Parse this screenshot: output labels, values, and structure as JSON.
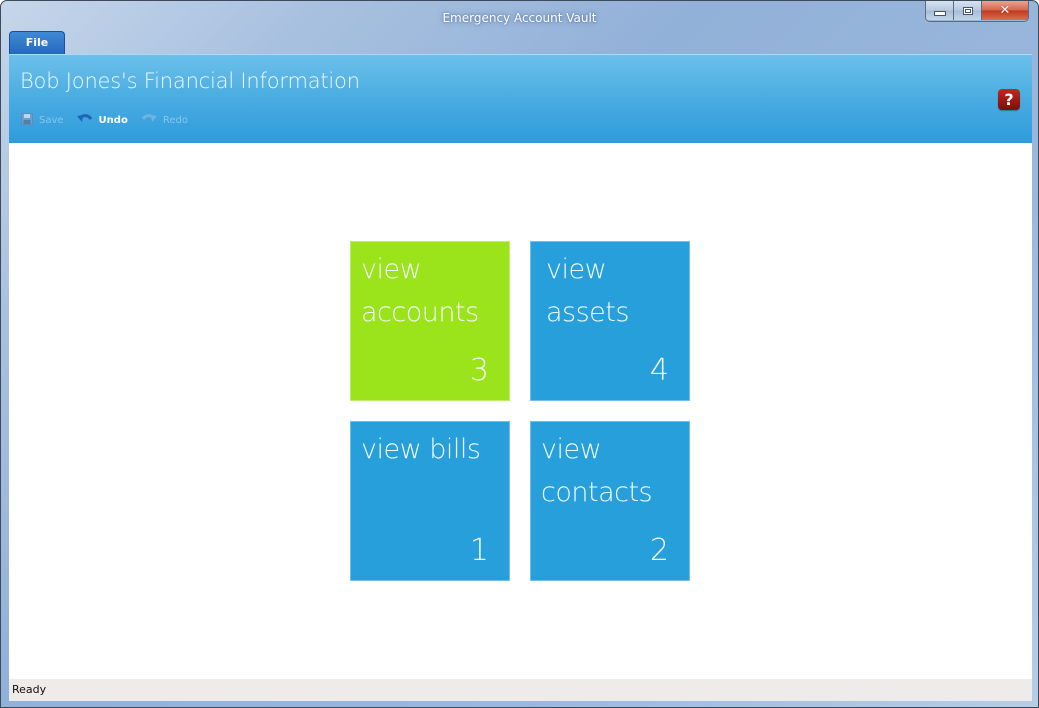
{
  "window": {
    "title": "Emergency Account Vault",
    "controls": {
      "minimize": "minimize",
      "maximize": "maximize",
      "close": "close"
    }
  },
  "menu": {
    "file_label": "File"
  },
  "header": {
    "title": "Bob Jones's Financial Information",
    "toolbar": [
      {
        "label": "Save",
        "icon": "floppy-disk-icon",
        "enabled": false
      },
      {
        "label": "Undo",
        "icon": "undo-arrow-icon",
        "enabled": true
      },
      {
        "label": "Redo",
        "icon": "redo-arrow-icon",
        "enabled": false
      }
    ],
    "help_glyph": "?"
  },
  "tiles": [
    {
      "label_line1": "view",
      "label_line2": "accounts",
      "count": "3",
      "color": "#9be31b"
    },
    {
      "label_line1": "view",
      "label_line2": "assets",
      "count": "4",
      "color": "#279fdb"
    },
    {
      "label_line1": "view bills",
      "label_line2": "",
      "count": "1",
      "color": "#279fdb"
    },
    {
      "label_line1": "view",
      "label_line2": "contacts",
      "count": "2",
      "color": "#279fdb"
    }
  ],
  "status": {
    "text": "Ready"
  },
  "colors": {
    "accent_green": "#9be31b",
    "accent_blue": "#279fdb",
    "help_red": "#a01814"
  }
}
